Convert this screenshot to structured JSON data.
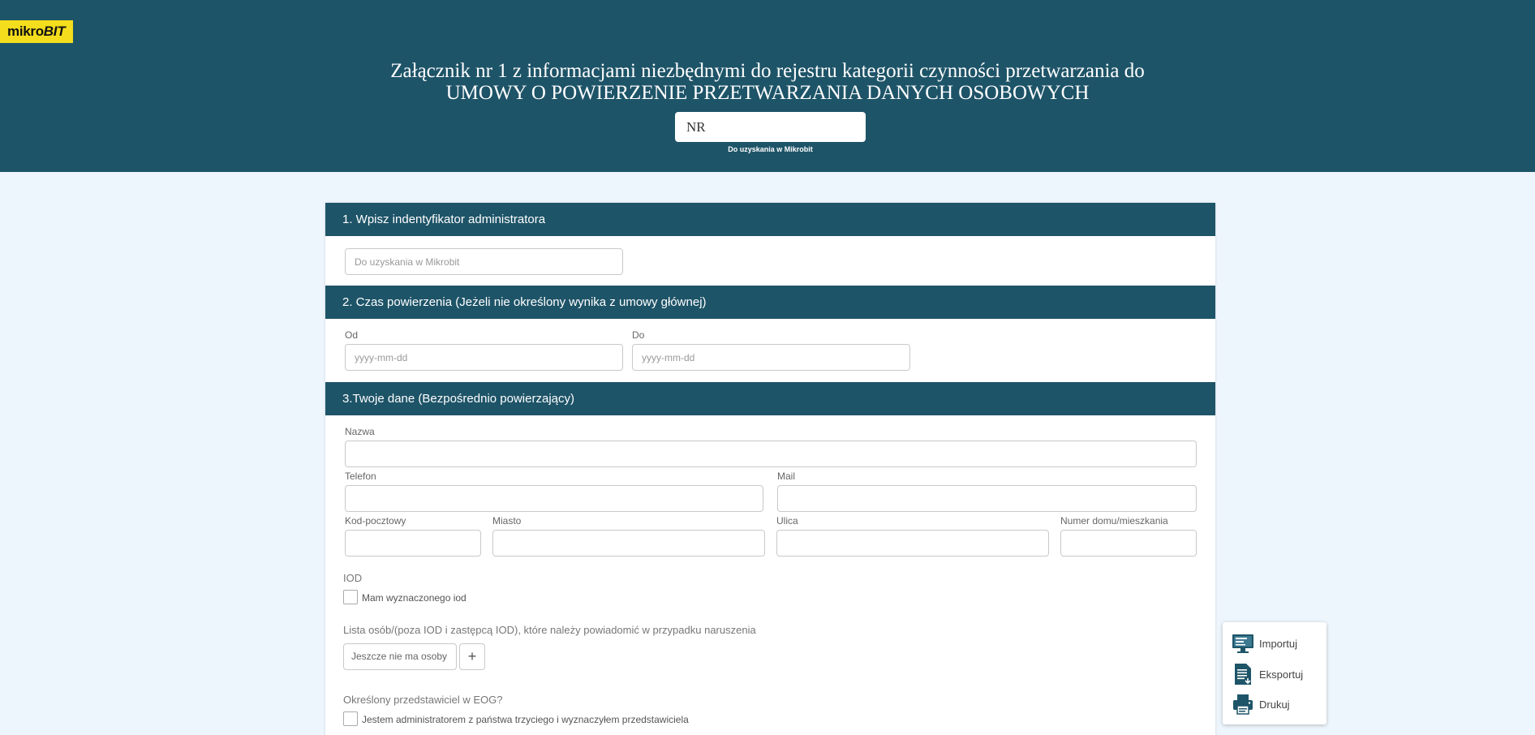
{
  "header": {
    "logo_prefix": "mikro",
    "logo_suffix": "BIT",
    "title_line1": "Załącznik nr 1 z informacjami niezbędnymi do rejestru kategorii czynności przetwarzania do",
    "title_line2": "UMOWY O POWIERZENIE PRZETWARZANIA DANYCH OSOBOWYCH",
    "nr_value": "NR",
    "nr_hint": "Do uzyskania w Mikrobit"
  },
  "section1": {
    "title": "1. Wpisz indentyfikator administratora",
    "admin_id_placeholder": "Do uzyskania w Mikrobit"
  },
  "section2": {
    "title": "2. Czas powierzenia (Jeżeli nie określony wynika z umowy głównej)",
    "from_label": "Od",
    "from_placeholder": "yyyy-mm-dd",
    "to_label": "Do",
    "to_placeholder": "yyyy-mm-dd"
  },
  "section3": {
    "title": "3.Twoje dane (Bezpośrednio powierzający)",
    "name_label": "Nazwa",
    "phone_label": "Telefon",
    "mail_label": "Mail",
    "postal_label": "Kod-pocztowy",
    "city_label": "Miasto",
    "street_label": "Ulica",
    "house_label": "Numer domu/mieszkania",
    "iod_heading": "IOD",
    "iod_checkbox": "Mam wyznaczonego iod",
    "persons_heading": "Lista osób/(poza IOD i zastępcą IOD), które należy powiadomić w przypadku naruszenia",
    "persons_empty": "Jeszcze nie ma osoby",
    "add_symbol": "+",
    "eog_heading": "Określony przedstawiciel w EOG?",
    "eog_checkbox": "Jestem administratorem z państwa trzyciego i wyznaczyłem przedstawiciela"
  },
  "side_menu": {
    "import_label": "Importuj",
    "export_label": "Eksportuj",
    "print_label": "Drukuj"
  },
  "colors": {
    "primary": "#1e5468",
    "logo_bg": "#f4dd1d",
    "page_bg": "#eef6fd"
  }
}
